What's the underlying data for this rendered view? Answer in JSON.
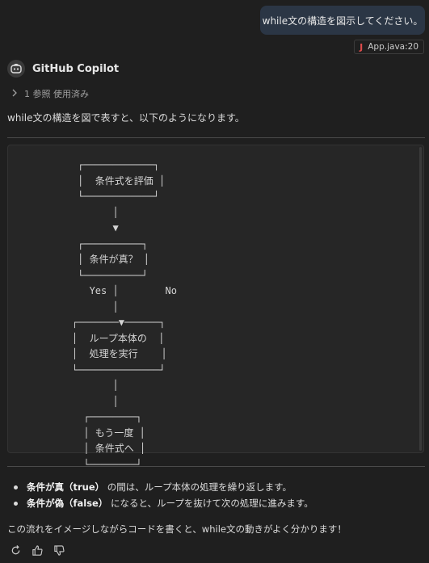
{
  "user_message": {
    "text": "while文の構造を図示してください。",
    "attachment": "App.java:20"
  },
  "assistant": {
    "name": "GitHub Copilot",
    "references": "1 参照 使用済み",
    "intro": "while文の構造を図で表すと、以下のようになります。",
    "diagram_lines": [
      "     ┌────────────┐",
      "     │  条件式を評価 │",
      "     └────────────┘",
      "           │",
      "           ▼",
      "     ┌──────────┐",
      "     │ 条件が真？ │",
      "     └──────────┘",
      "       Yes │        No",
      "           │",
      "    ┌───────▼──────┐",
      "    │  ループ本体の  │",
      "    │  処理を実行    │",
      "    └──────────────┘",
      "           │",
      "           │",
      "      ┌────────┐",
      "      │ もう一度 │",
      "      │ 条件式へ │",
      "      └────────┘"
    ],
    "bullets": [
      {
        "bold": "条件が真（true）",
        "rest": " の間は、ループ本体の処理を繰り返します。"
      },
      {
        "bold": "条件が偽（false）",
        "rest": " になると、ループを抜けて次の処理に進みます。"
      }
    ],
    "outro": "この流れをイメージしながらコードを書くと、while文の動きがよく分かります！"
  },
  "icons": {
    "file": "java-icon",
    "avatar": "copilot-icon",
    "refs_toggle": "chevron-right-icon",
    "retry": "retry-icon",
    "like": "thumbs-up-icon",
    "dislike": "thumbs-down-icon"
  },
  "colors": {
    "background": "#1f1f1f",
    "user_bubble": "#2b3645",
    "code_background": "#262626",
    "java_icon": "#e04c4c"
  }
}
